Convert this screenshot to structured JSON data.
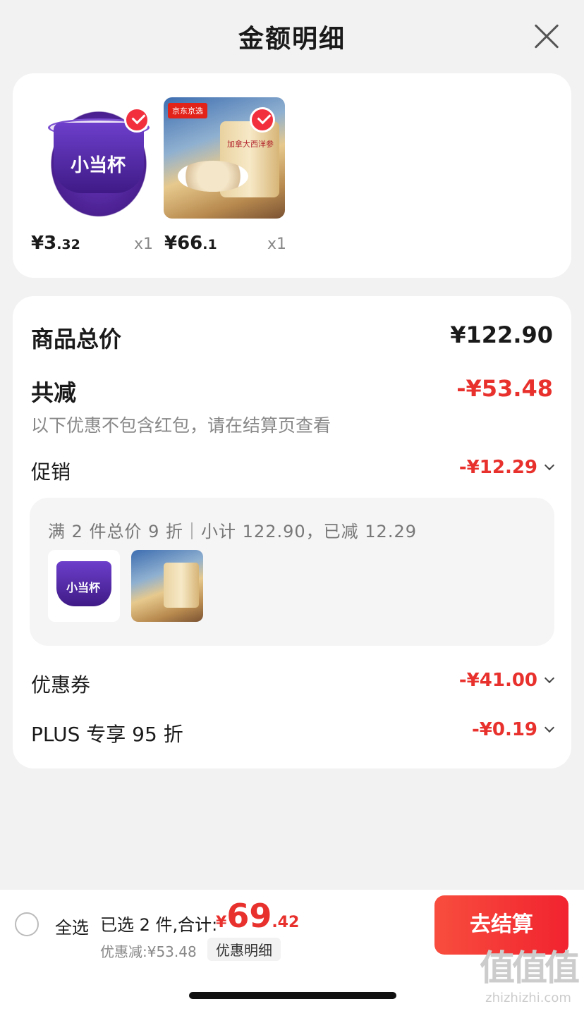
{
  "header": {
    "title": "金额明细"
  },
  "products": [
    {
      "brand": "小当杯",
      "price_int": "¥3",
      "price_dec": ".32",
      "qty": "x1"
    },
    {
      "tag": "京东京选",
      "can_label": "加拿大西洋参",
      "price_int": "¥66",
      "price_dec": ".1",
      "qty": "x1"
    }
  ],
  "summary": {
    "total_label": "商品总价",
    "total_value": "¥122.90",
    "reduce_label": "共减",
    "reduce_value": "-¥53.48",
    "reduce_note": "以下优惠不包含红包，请在结算页查看",
    "promo_label": "促销",
    "promo_value": "-¥12.29",
    "promo_detail": "满 2 件总价 9 折｜小计 122.90，已减 12.29",
    "coupon_label": "优惠券",
    "coupon_value": "-¥41.00",
    "plus_label": "PLUS 专享 95 折",
    "plus_value": "-¥0.19"
  },
  "bottom_bar": {
    "select_all": "全选",
    "selected_info": "已选 2 件,合计:",
    "total_currency": "¥",
    "total_int": "69",
    "total_dec": ".42",
    "discount_text": "优惠减:¥53.48",
    "detail_button": "优惠明细",
    "checkout_button": "去结算"
  },
  "watermark": {
    "big": "值值值",
    "small": "zhizhizhi.com"
  },
  "colors": {
    "accent": "#e8302c",
    "checkout": "#f1232f"
  }
}
